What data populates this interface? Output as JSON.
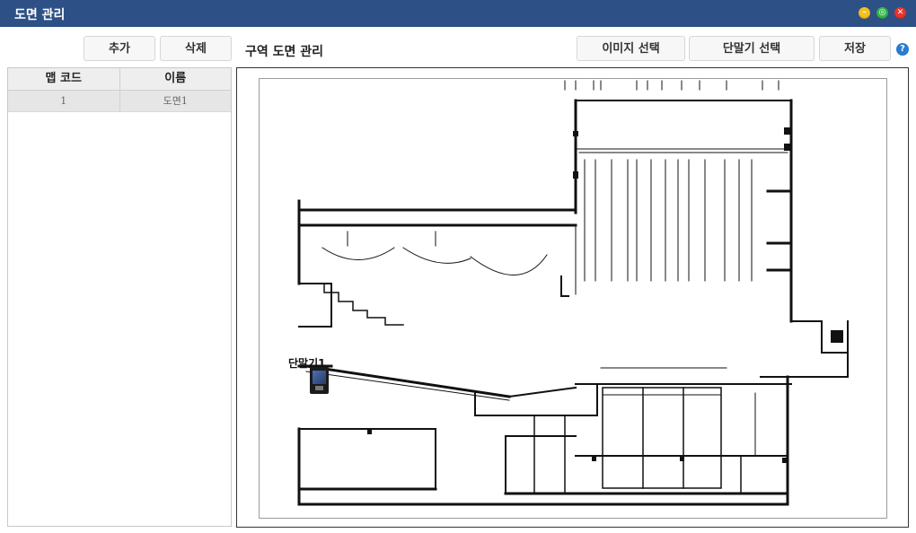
{
  "window": {
    "title": "도면 관리",
    "controls": {
      "minimize": "–",
      "restore": "◎",
      "close": "✕"
    }
  },
  "toolbar": {
    "add_label": "추가",
    "delete_label": "삭제",
    "section_title": "구역 도면 관리",
    "select_image_label": "이미지 선택",
    "select_terminal_label": "단말기 선택",
    "save_label": "저장",
    "help_icon": "?"
  },
  "map_table": {
    "columns": [
      "맵 코드",
      "이름"
    ],
    "rows": [
      {
        "code": "1",
        "name": "도면1"
      }
    ]
  },
  "floor_plan": {
    "terminal_label": "단말기1",
    "terminal_icon": "terminal-device-icon"
  },
  "colors": {
    "titlebar": "#2d5086",
    "minimize": "#f4c01b",
    "restore": "#34b648",
    "close": "#e8342c",
    "help": "#2a7ad1"
  }
}
